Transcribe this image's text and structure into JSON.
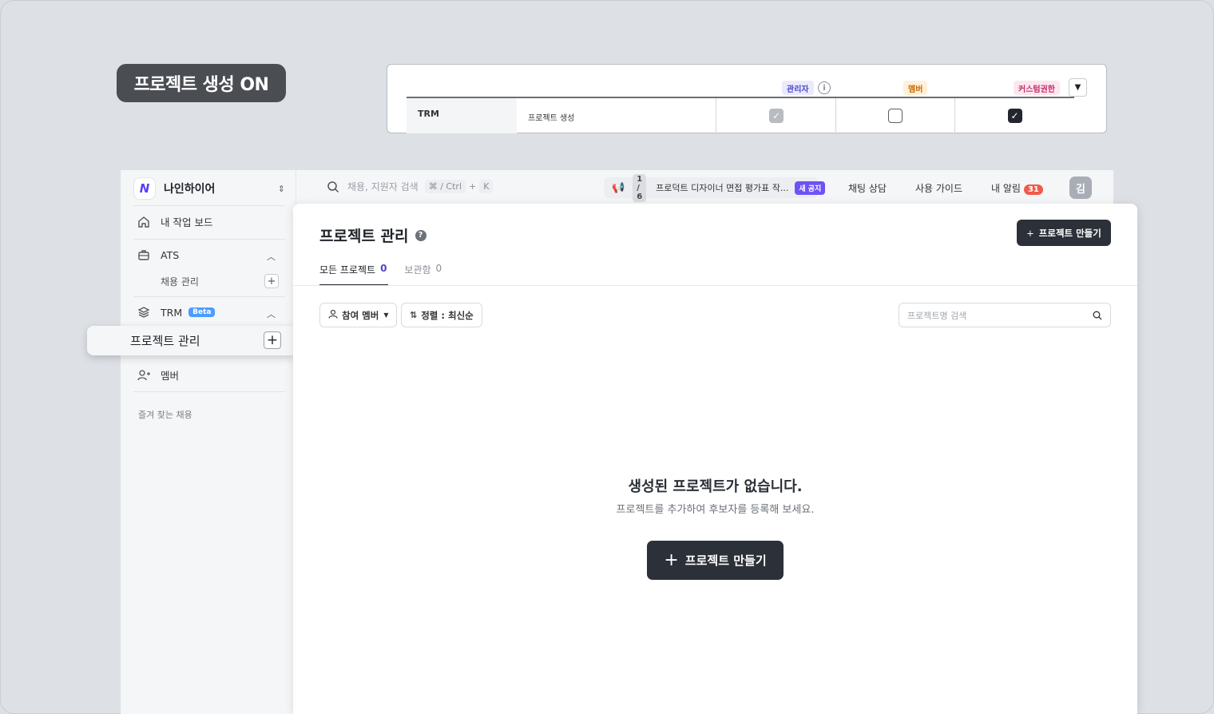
{
  "banner": {
    "label": "프로젝트 생성 ON"
  },
  "permissions": {
    "roles": {
      "admin": "관리자",
      "member": "멤버",
      "custom": "커스텀권한"
    },
    "row": {
      "category": "TRM",
      "name": "프로젝트 생성"
    }
  },
  "sidebar": {
    "org_name": "나인하이어",
    "my_board": "내 작업 보드",
    "ats": "ATS",
    "ats_sub": "채용 관리",
    "trm": "TRM",
    "beta": "Beta",
    "active_item": "프로젝트 관리",
    "member": "멤버",
    "favorites": "즐겨 찾는 채용"
  },
  "topbar": {
    "search_placeholder": "채용, 지원자 검색",
    "shortcut": "⌘ / Ctrl",
    "shortcut_plus": "+",
    "shortcut_key": "K",
    "notice_count": "1 / 6",
    "notice_text": "프로덕트 디자이너 면접 평가표 작...",
    "notice_badge": "새 공지",
    "chat": "채팅 상담",
    "guide": "사용 가이드",
    "alerts": "내 알림",
    "alerts_count": "31",
    "avatar": "김"
  },
  "main": {
    "title": "프로젝트 관리",
    "create_label": "프로젝트 만들기",
    "tabs": [
      {
        "label": "모든 프로젝트",
        "count": "0"
      },
      {
        "label": "보관함",
        "count": "0"
      }
    ],
    "filter_member": "참여 멤버",
    "sort": "정렬 : 최신순",
    "search_placeholder": "프로젝트명 검색",
    "empty_title": "생성된 프로젝트가 없습니다.",
    "empty_sub": "프로젝트를 추가하여 후보자를 등록해 보세요."
  }
}
